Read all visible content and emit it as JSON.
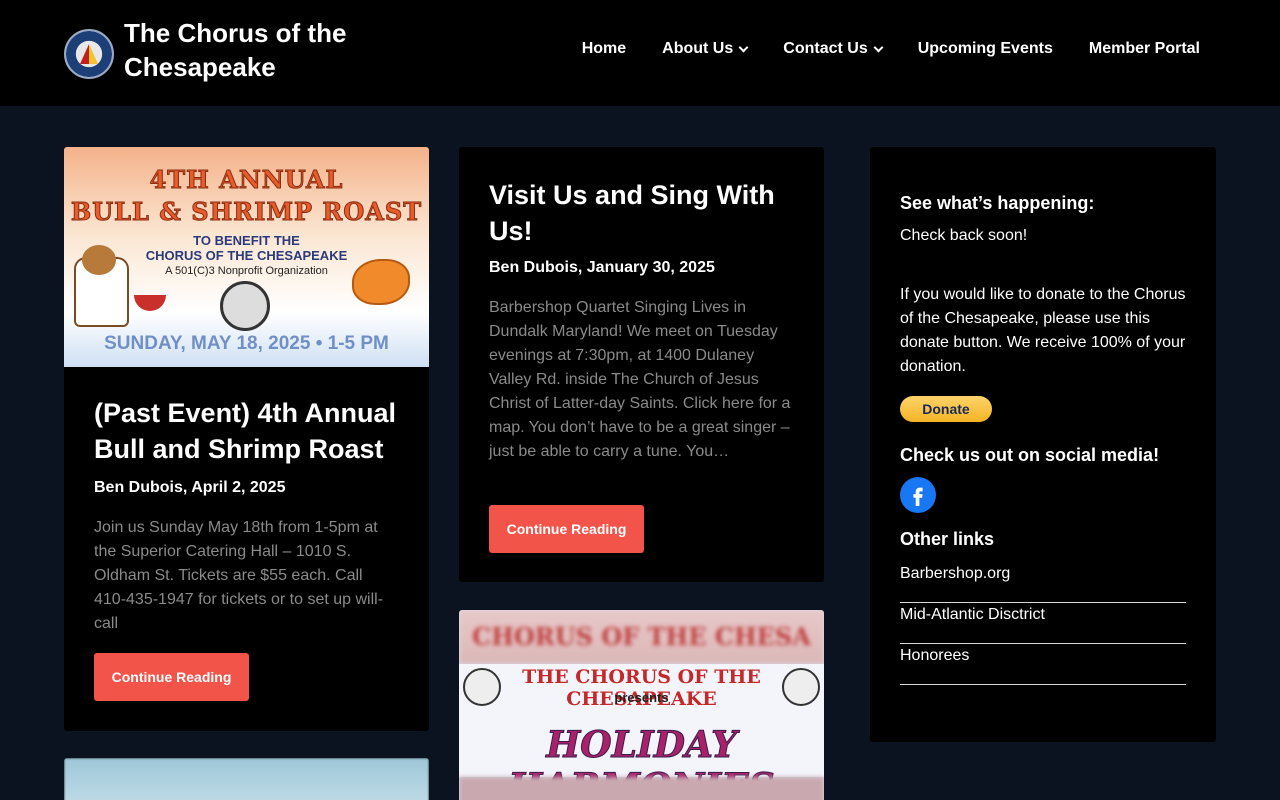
{
  "header": {
    "site_title": "The Chorus of the Chesapeake",
    "nav": [
      "Home",
      "About Us",
      "Contact Us",
      "Upcoming Events",
      "Member Portal"
    ]
  },
  "posts": [
    {
      "image": {
        "line1": "4TH ANNUAL",
        "line2": "BULL & SHRIMP ROAST",
        "line3": "TO BENEFIT THE",
        "line4": "CHORUS OF THE CHESAPEAKE",
        "line5": "A 501(C)3 Nonprofit Organization",
        "line6": "SUNDAY, MAY 18, 2025 • 1-5 PM"
      },
      "title": "(Past Event) 4th Annual Bull and Shrimp Roast",
      "meta": "Ben Dubois, April 2, 2025",
      "excerpt": "Join us Sunday May 18th from 1-5pm at the Superior Catering Hall – 1010 S. Oldham St. Tickets are $55 each. Call 410-435-1947 for tickets or to set up will-call",
      "button": "Continue Reading"
    },
    {
      "title": "Visit Us and Sing With Us!",
      "meta": "Ben Dubois, January 30, 2025",
      "excerpt": "Barbershop Quartet Singing Lives in Dundalk Maryland! We meet on Tuesday evenings at 7:30pm, at 1400 Dulaney Valley Rd. inside The Church of Jesus Christ of Latter-day Saints.   Click here for a map. You don’t have to be a great singer – just be able to carry a tune. You…",
      "button": "Continue Reading"
    },
    {
      "image": {
        "top": "CHORUS OF THE CHESA",
        "line1": "THE CHORUS OF THE CHESAPEAKE",
        "line2": "presents",
        "line3": "HOLIDAY HARMONIES"
      }
    }
  ],
  "sidebar": {
    "heading1": "See what’s happening:",
    "text1": "Check back soon!",
    "text2": "If you would like to donate to the Chorus of the Chesapeake, please use this donate button. We receive 100% of your donation.",
    "donate_label": "Donate",
    "heading2": "Check us out on social media!",
    "heading3": "Other links",
    "links": [
      "Barbershop.org",
      "Mid-Atlantic Disctrict",
      "Honorees"
    ]
  },
  "colors": {
    "accent": "#f2544a",
    "facebook": "#1877f2",
    "background": "#0b1220"
  }
}
